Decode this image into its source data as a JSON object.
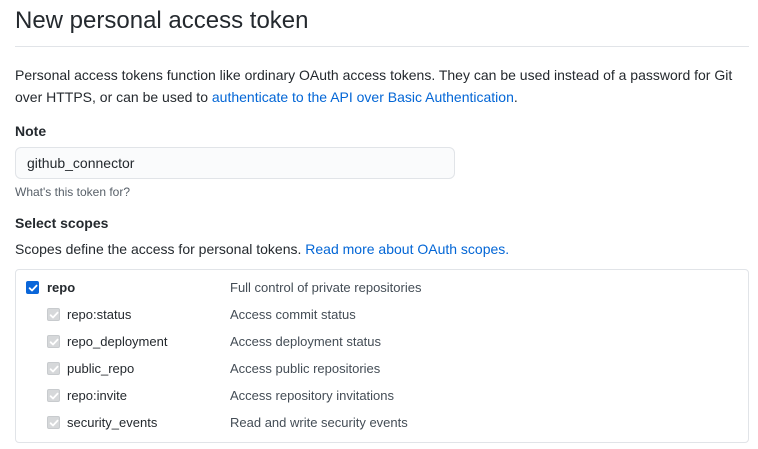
{
  "header": {
    "title": "New personal access token"
  },
  "intro": {
    "text": "Personal access tokens function like ordinary OAuth access tokens. They can be used instead of a password for Git over HTTPS, or can be used to ",
    "link_text": "authenticate to the API over Basic Authentication",
    "suffix": "."
  },
  "note": {
    "label": "Note",
    "value": "github_connector",
    "hint": "What's this token for?"
  },
  "scopes": {
    "label": "Select scopes",
    "description": "Scopes define the access for personal tokens. ",
    "link_text": "Read more about OAuth scopes.",
    "primary": {
      "name": "repo",
      "description": "Full control of private repositories",
      "checked": true
    },
    "items": [
      {
        "name": "repo:status",
        "description": "Access commit status",
        "checked": true
      },
      {
        "name": "repo_deployment",
        "description": "Access deployment status",
        "checked": true
      },
      {
        "name": "public_repo",
        "description": "Access public repositories",
        "checked": true
      },
      {
        "name": "repo:invite",
        "description": "Access repository invitations",
        "checked": true
      },
      {
        "name": "security_events",
        "description": "Read and write security events",
        "checked": true
      }
    ]
  },
  "colors": {
    "link": "#0366d6",
    "checkbox_primary": "#0a66d9",
    "checkbox_disabled": "#d6d8da",
    "border": "#e1e4e8"
  },
  "icons": {
    "checkmark": "check-icon"
  }
}
